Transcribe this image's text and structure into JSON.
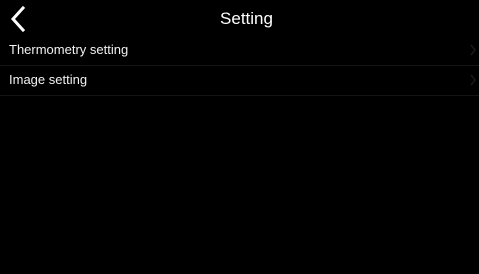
{
  "header": {
    "title": "Setting",
    "back_icon": "chevron-left-icon"
  },
  "menu": {
    "items": [
      {
        "label": "Thermometry setting",
        "icon": "chevron-right-icon"
      },
      {
        "label": "Image setting",
        "icon": "chevron-right-icon"
      }
    ]
  },
  "colors": {
    "background": "#000000",
    "text": "#ffffff",
    "divider": "#151515"
  }
}
